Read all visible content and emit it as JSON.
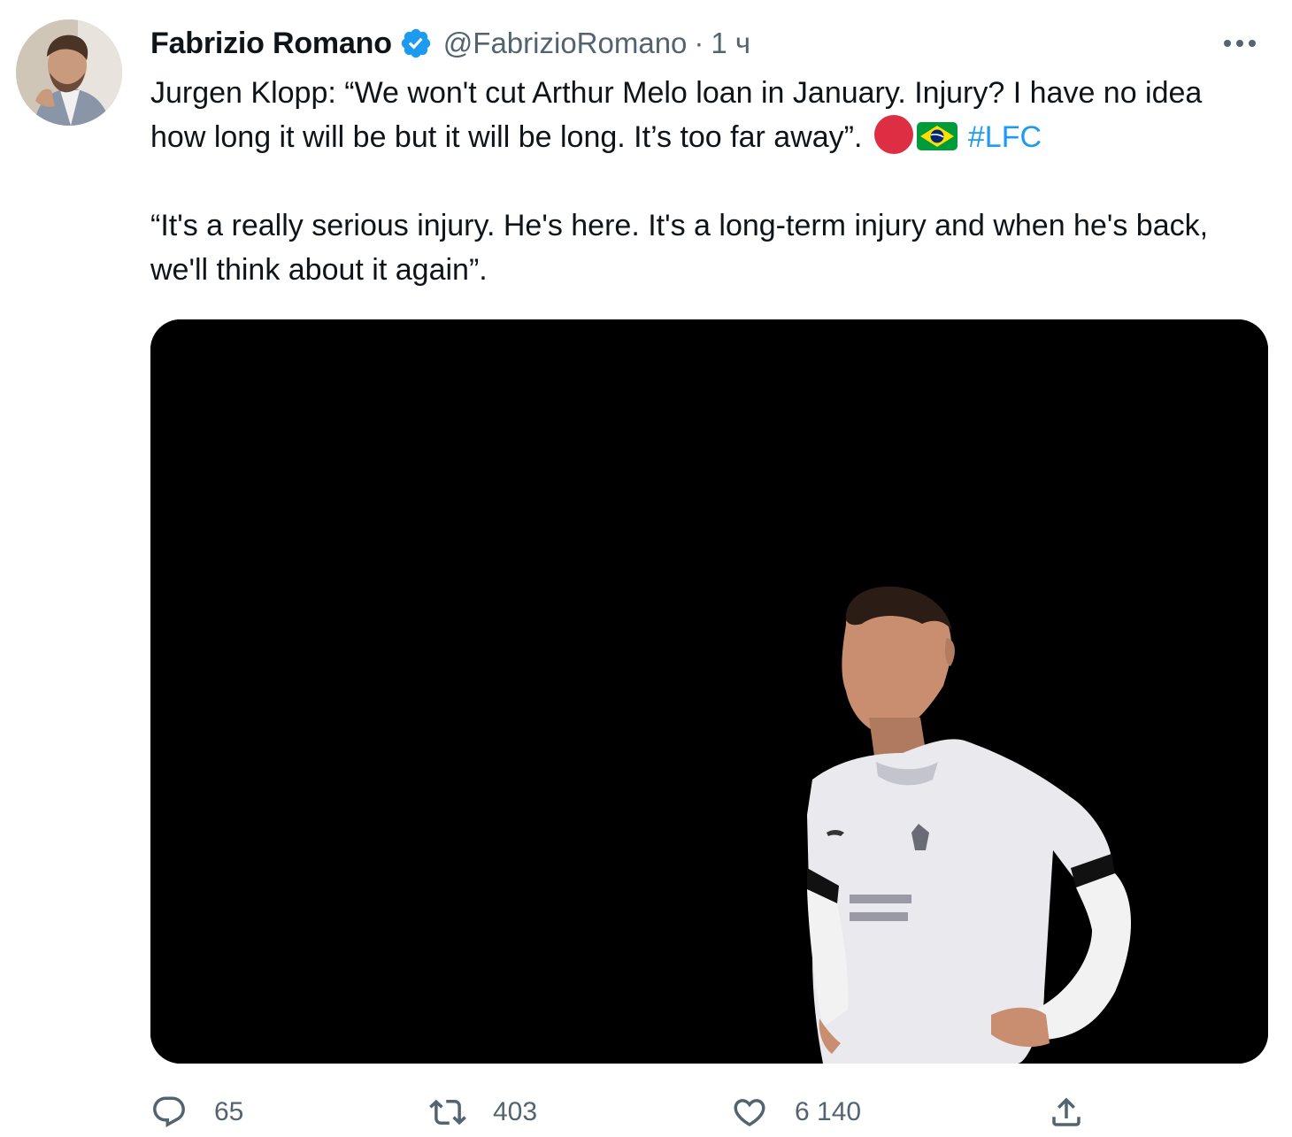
{
  "tweet": {
    "author": {
      "display_name": "Fabrizio Romano",
      "handle": "@FabrizioRomano",
      "verified_icon": "verified-badge-icon"
    },
    "separator": "·",
    "time": "1 ч",
    "more_icon": "more-dots-icon",
    "text": {
      "line1": "Jurgen Klopp: “We won't cut Arthur Melo loan in January. Injury? I have no idea how long it will be but it will be long. It’s too far away”.",
      "hashtag": "#LFC",
      "paragraph2": "“It's a really serious injury. He's here. It's a long-term injury and when he's back, we'll think about it again”."
    },
    "emojis": [
      "red-circle-emoji",
      "brazil-flag-emoji"
    ],
    "media": {
      "type": "photo",
      "background": "#000000"
    },
    "actions": {
      "replies": "65",
      "retweets": "403",
      "likes": "6 140",
      "icons": [
        "reply-icon",
        "retweet-icon",
        "like-icon",
        "share-icon"
      ]
    },
    "colors": {
      "link": "#1d9bf0",
      "secondary_text": "#536471",
      "primary_text": "#0f1419",
      "verified": "#1d9bf0"
    }
  }
}
